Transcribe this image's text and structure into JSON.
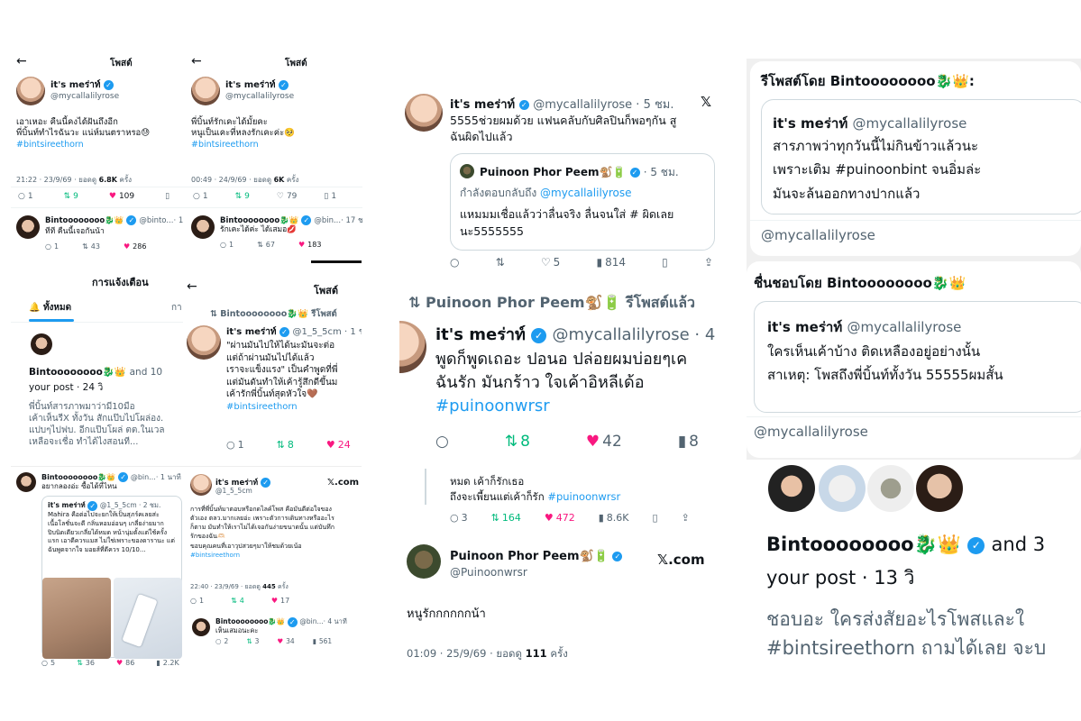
{
  "p1": {
    "back": "←",
    "title": "โพสต์",
    "name": "it's meร่าท์",
    "handle": "@mycallalilyrose",
    "text": [
      "เอาเหอะ คืนนี้คงได้ฝันถึงอีก",
      "พี่บิ้นท์ทำไรฉันวะ แน่ห์มนตราหรอ😓"
    ],
    "tag": "#bintsireethorn",
    "meta_a": "21:22 · 23/9/69 · ยอดดู ",
    "meta_b": "6.8K",
    "meta_c": " ครั้ง",
    "a": [
      "1",
      "9",
      "109"
    ],
    "rname": "Bintoooooooo🐉👑",
    "rhandle": "@binto...",
    "rtime": "· 1",
    "rtext": "ทีที คืนนี้เจอกันน้า",
    "ra": [
      "1",
      "43",
      "286"
    ]
  },
  "p2": {
    "back": "←",
    "title": "โพสต์",
    "name": "it's meร่าท์",
    "handle": "@mycallalilyrose",
    "text": [
      "พี่บิ้นท์รักเคะได้มั้ยคะ",
      "หนูเป็นเคะที่หลงรักเคะค่ะ🥺"
    ],
    "tag": "#bintsireethorn",
    "meta_a": "00:49 · 24/9/69 · ยอดดู ",
    "meta_b": "6K",
    "meta_c": " ครั้ง",
    "a": [
      "1",
      "9",
      "79",
      "1"
    ],
    "rname": "Bintoooooooo🐉👑",
    "rhandle": "@bin...",
    "rtime": "· 17 ช",
    "rtext": "รักเคะได้ค่ะ ได้เสมอ💋",
    "ra": [
      "1",
      "67",
      "183"
    ]
  },
  "p3": {
    "title": "การแจ้งเตือน",
    "tab_all": "ทั้งหมด",
    "tab2": "กา",
    "name": "Bintoooooooo🐉👑",
    "and": "and 10",
    "line2": "your post · 24 วิ",
    "text": [
      "พี่บิ้นท์สารภาพมาว่ามี10มือ",
      "เค้าเห็นรีX ทั้งวัน สักแป๊บไปโผล่อง.",
      "แปบๆไปฟบ. อีกแป๊บโผล่ ตต.ในเวล",
      "เหลือจะเชื่อ ทำได้ไงสอนที..."
    ]
  },
  "p4": {
    "back": "←",
    "title": "โพสต์",
    "rt": "Bintoooooooo🐉👑 รีโพสต์",
    "name": "it's meร่าท์",
    "handle": "@1_5_5cm · 1 ช",
    "text": [
      "\"ผ่านมันไปให้ได้นะมันจะต่อ",
      "แต่ถ้าผ่านมันไปได้แล้ว",
      "เราจะแข็งแรง\" เป็นคำพูดที่พี่",
      "แต่มันดันทำให้เค้ารู้สึกดีขึ้นม",
      "เค้ารักพี่บิ้นท์สุดหัวใจ🤎"
    ],
    "tag": "#bintsireethorn",
    "a": [
      "1",
      "8",
      "24"
    ]
  },
  "p5": {
    "name": "Bintoooooooo🐉👑",
    "handle": "@bin...",
    "time": "· 1 นาที",
    "reply": "อยากลองอ่ะ ซื้อได้ที่ไหน",
    "qname": "it's meร่าท์",
    "qhandle": "@1_5_5cm · 2 ชม.",
    "qtext": [
      "Mahira คือต่อไปจะยกให้เป็นสุภร์คเลยส่ะ",
      "เนื้อโลชั่นจะดี กลิ่นหอมอ่อนๆ เกลี่ยง่ายมาก",
      "ปิบนิดเดียวเกลี่ยได้หมด หน้านุ่มตั้งแต่ใช้ครั้ง",
      "แรก เอาดีควรแมส ไม่ใช่เพราะของดารานะ แต่",
      "ฉันพูดจากใจ มอยส์ที่ดีควร 10/10..."
    ],
    "a": [
      "5",
      "36",
      "86",
      "2.2K"
    ]
  },
  "p6": {
    "name": "it's meร่าท์",
    "handle": "@1_5_5cm",
    "xcom": "𝕏.com",
    "text": [
      "การที่พี่บิ้นท์มาตอบหรือกดไลค์โพส คือมันดีต่อใจของ",
      "ตัวเอง ตลว.มากเลยอ่ะ เพราะตัวการเดินทางหรืออะไร",
      "ก็ตาม มันทำให้เราไม่ได้เจอกันง่ายขนาดนั้น แต่บันทึก",
      "รักของฉัน🫶🏻",
      "ขอบคุณคนที่เอาวุปสวยๆมาให้ชมด้วยเน้อ"
    ],
    "tag": "#bintsireethorn",
    "meta_a": "22:40 · 23/9/69 · ยอดดู ",
    "meta_b": "445",
    "meta_c": " ครั้ง",
    "a": [
      "1",
      "4",
      "17"
    ],
    "rname": "Bintoooooooo🐉👑",
    "rhandle": "@bin...",
    "rtime": "· 4 นาที",
    "rtext": "เห็นเสมอนะคะ",
    "ra": [
      "2",
      "3",
      "34",
      "561"
    ]
  },
  "p7": {
    "name": "it's meร่าท์",
    "handle": "@mycallalilyrose · 5 ชม.",
    "text": [
      "5555ช่วยผมด้วย แฟนคลับกับศิลปินก็พอๆกัน สู",
      "ฉันผิดไปแล้ว"
    ],
    "qname": "Puinoon Phor Peem🐒🔋",
    "qtime": "· 5 ชม.",
    "qreply_a": "กำลังตอบกลับถึง ",
    "qreply_b": "@mycallalilyrose",
    "qtext": [
      "แหมมมเชื่อแล้วว่าลื่นจริง ลื่นจนใส่ # ผิดเลย",
      "นะ5555555"
    ],
    "a": [
      "5",
      "814"
    ]
  },
  "p8": {
    "rt": "Puinoon Phor Peem🐒🔋 รีโพสต์แล้ว",
    "name": "it's meร่าท์",
    "handle": "@mycallalilyrose · 4",
    "text": [
      "พูดก็พูดเถอะ ปอนอ ปล่อยผมบ่อยๆเค",
      "ฉันรัก มันกร้าว ใจเค้าอิหลีเด้อ"
    ],
    "tag": "#puinoonwrsr",
    "a": [
      "8",
      "42",
      "8"
    ]
  },
  "p9": {
    "text1": "หมด เค้าก็รักเธอ",
    "text2": "ถึงจะเพี้ยนแต่เค้าก็รัก ",
    "tag": "#puinoonwrsr",
    "a": [
      "3",
      "164",
      "472",
      "8.6K"
    ],
    "name": "Puinoon Phor Peem🐒🔋",
    "handle": "@Puinoonwrsr",
    "xcom": "𝕏.com",
    "body": "หนูรักกกกกกน้า",
    "meta_a": "01:09 · 25/9/69 · ยอดดู ",
    "meta_b": "111",
    "meta_c": " ครั้ง"
  },
  "p10": {
    "hdr": "รีโพสต์โดย Bintoooooooo🐉👑:",
    "qname": "it's meร่าท์",
    "qhandle": "@mycallalilyrose",
    "qtext": [
      "สารภาพว่าทุกวันนี้ไม่กินข้าวแล้วนะ",
      "เพราะเติม #puinoonbint จนอิ่มล่ะ",
      "มันจะล้นออกทางปากแล้ว"
    ],
    "foot": "@mycallalilyrose"
  },
  "p11": {
    "hdr": "ชื่นชอบโดย Bintoooooooo🐉👑",
    "qname": "it's meร่าท์",
    "qhandle": "@mycallalilyrose",
    "qtext": [
      "ใครเห็นเค้าบ้าง ติดเหลืองอยู่อย่างนั้น",
      "สาเหตุ: โพสถึงพี่บิ้นท์ทั้งวัน 55555ผมสั้น"
    ],
    "foot": "@mycallalilyrose"
  },
  "p12": {
    "name": "Bintoooooooo🐉👑",
    "and": "and 3",
    "line2": "your post · 13 วิ",
    "text1": "ชอบอะ ใครส่งสัยอะไรโพสและใ",
    "tag": "#bintsireethorn ถามได้เลย จะบ"
  }
}
